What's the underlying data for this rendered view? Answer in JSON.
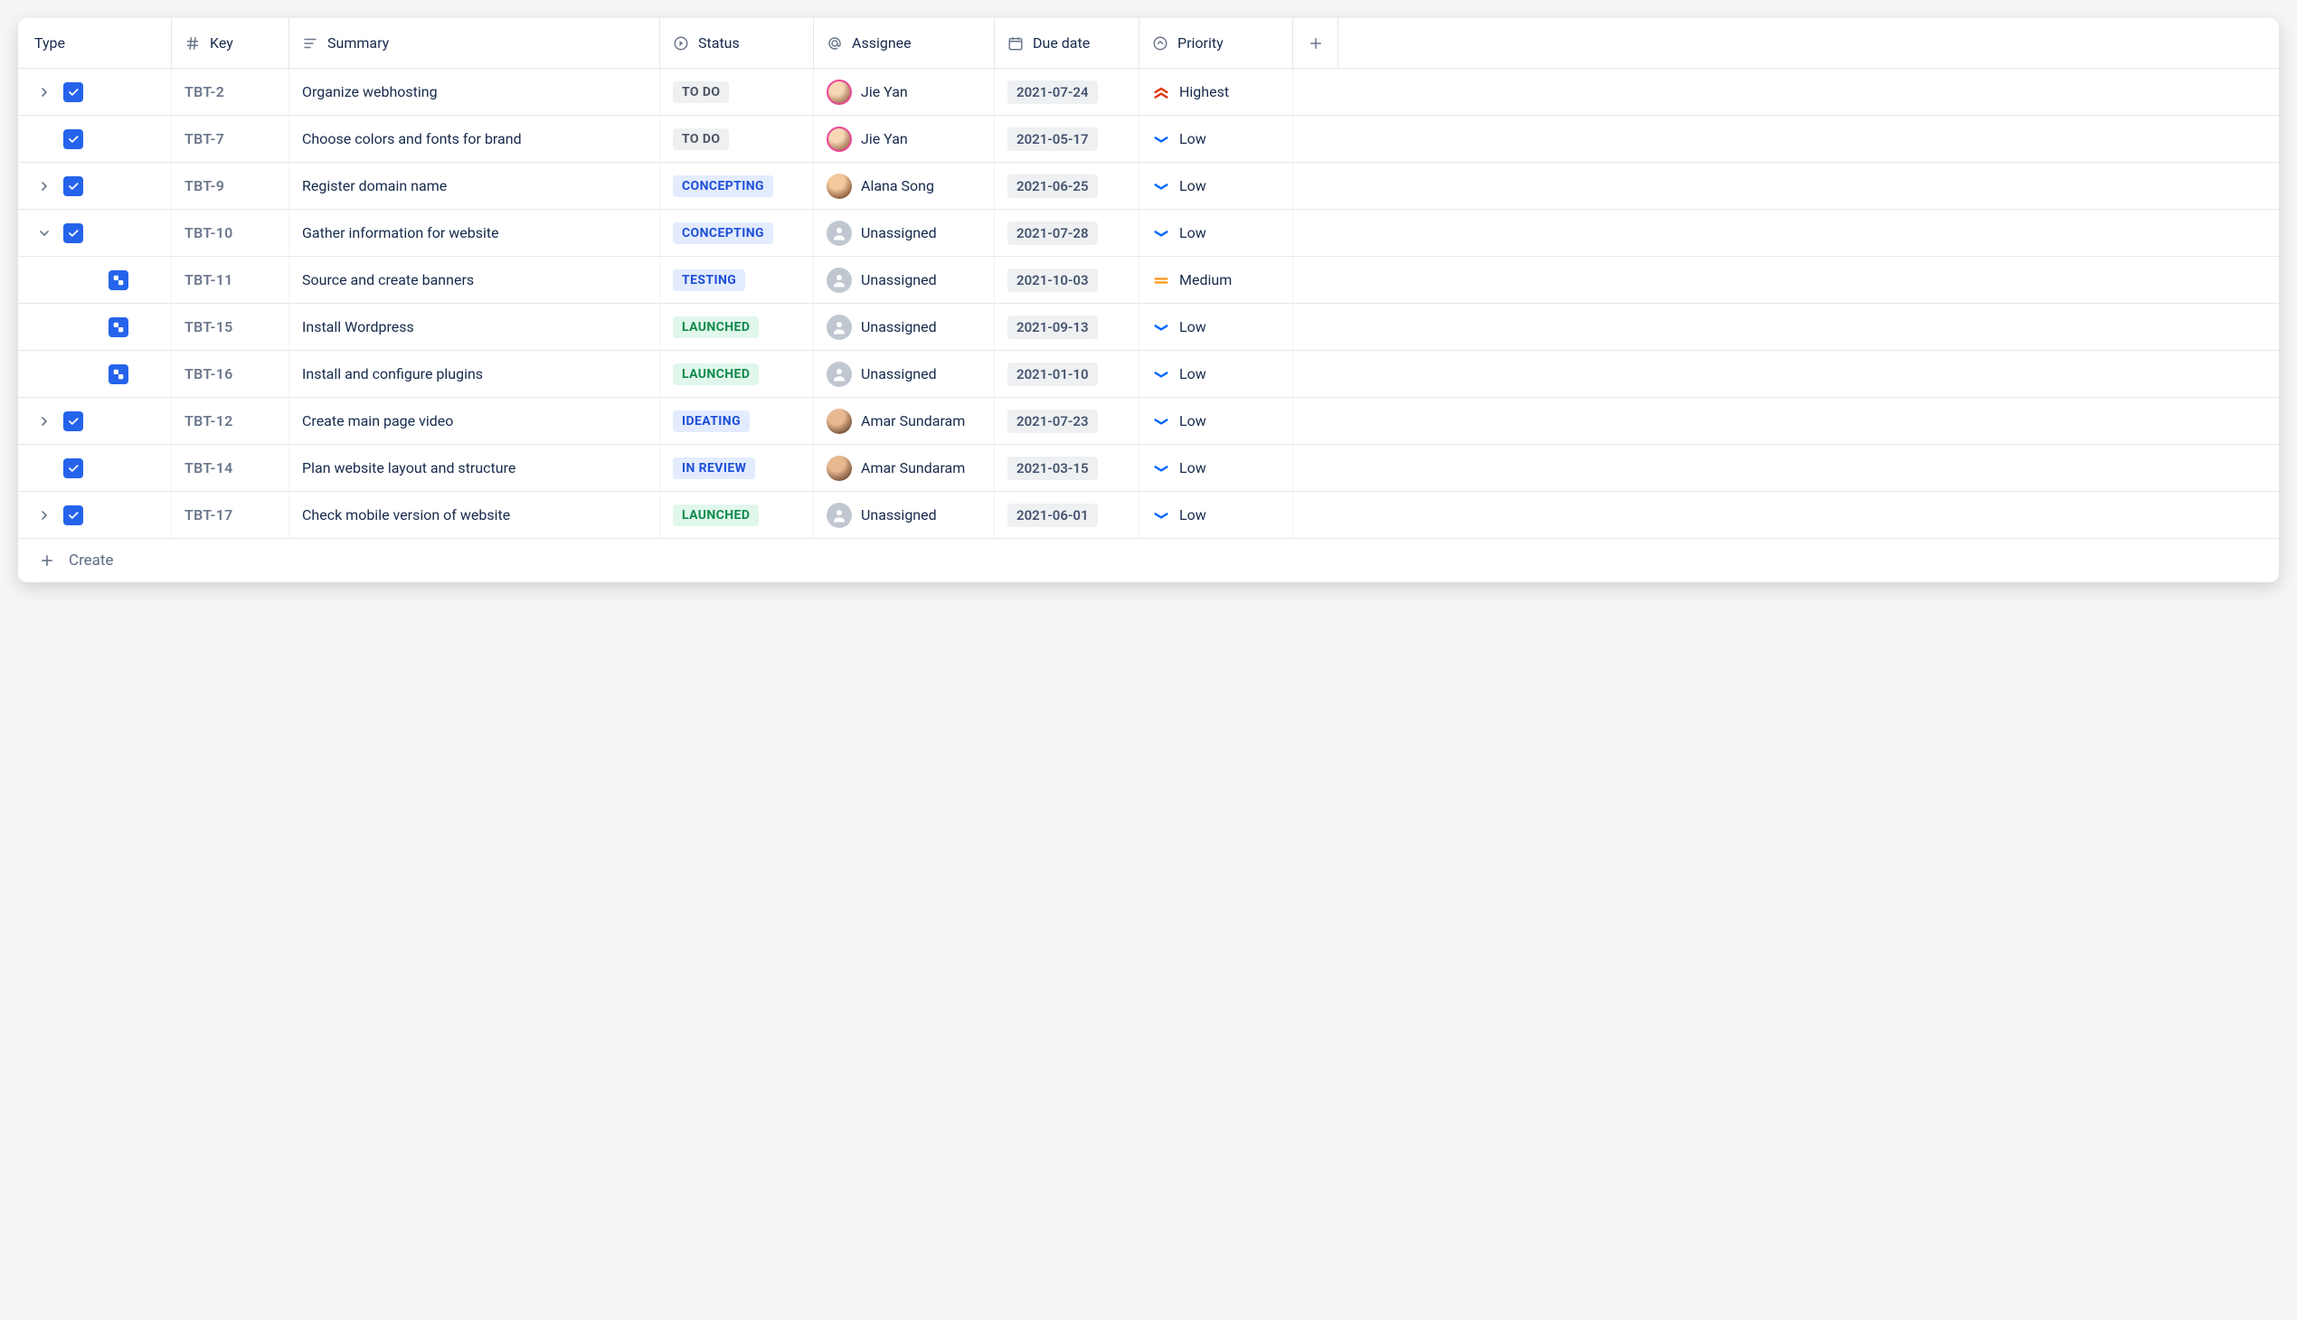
{
  "columns": {
    "type": "Type",
    "key": "Key",
    "summary": "Summary",
    "status": "Status",
    "assignee": "Assignee",
    "due_date": "Due date",
    "priority": "Priority"
  },
  "create_label": "Create",
  "priority_labels": {
    "highest": "Highest",
    "medium": "Medium",
    "low": "Low"
  },
  "status_styles": {
    "TO DO": "status-todo",
    "CONCEPTING": "status-blue",
    "IDEATING": "status-blue",
    "IN REVIEW": "status-blue",
    "TESTING": "status-blue",
    "LAUNCHED": "status-green"
  },
  "rows": [
    {
      "expand": "closed",
      "indent": 0,
      "icon": "task",
      "key": "TBT-2",
      "summary": "Organize webhosting",
      "status": "TO DO",
      "assignee": "Jie Yan",
      "avatar": "a1",
      "due": "2021-07-24",
      "priority": "highest"
    },
    {
      "expand": "none",
      "indent": 0,
      "icon": "task",
      "key": "TBT-7",
      "summary": "Choose colors and fonts for brand",
      "status": "TO DO",
      "assignee": "Jie Yan",
      "avatar": "a1",
      "due": "2021-05-17",
      "priority": "low"
    },
    {
      "expand": "closed",
      "indent": 0,
      "icon": "task",
      "key": "TBT-9",
      "summary": "Register domain name",
      "status": "CONCEPTING",
      "assignee": "Alana Song",
      "avatar": "a2",
      "due": "2021-06-25",
      "priority": "low"
    },
    {
      "expand": "open",
      "indent": 0,
      "icon": "task",
      "key": "TBT-10",
      "summary": "Gather information for website",
      "status": "CONCEPTING",
      "assignee": "Unassigned",
      "avatar": "unassigned",
      "due": "2021-07-28",
      "priority": "low"
    },
    {
      "expand": "none",
      "indent": 1,
      "icon": "subtask",
      "key": "TBT-11",
      "summary": "Source and create banners",
      "status": "TESTING",
      "assignee": "Unassigned",
      "avatar": "unassigned",
      "due": "2021-10-03",
      "priority": "medium"
    },
    {
      "expand": "none",
      "indent": 1,
      "icon": "subtask",
      "key": "TBT-15",
      "summary": "Install Wordpress",
      "status": "LAUNCHED",
      "assignee": "Unassigned",
      "avatar": "unassigned",
      "due": "2021-09-13",
      "priority": "low"
    },
    {
      "expand": "none",
      "indent": 1,
      "icon": "subtask",
      "key": "TBT-16",
      "summary": "Install and configure plugins",
      "status": "LAUNCHED",
      "assignee": "Unassigned",
      "avatar": "unassigned",
      "due": "2021-01-10",
      "priority": "low"
    },
    {
      "expand": "closed",
      "indent": 0,
      "icon": "task",
      "key": "TBT-12",
      "summary": "Create main page video",
      "status": "IDEATING",
      "assignee": "Amar Sundaram",
      "avatar": "a3",
      "due": "2021-07-23",
      "priority": "low"
    },
    {
      "expand": "none",
      "indent": 0,
      "icon": "task",
      "key": "TBT-14",
      "summary": "Plan website layout and structure",
      "status": "IN REVIEW",
      "assignee": "Amar Sundaram",
      "avatar": "a3",
      "due": "2021-03-15",
      "priority": "low"
    },
    {
      "expand": "closed",
      "indent": 0,
      "icon": "task",
      "key": "TBT-17",
      "summary": "Check mobile version of website",
      "status": "LAUNCHED",
      "assignee": "Unassigned",
      "avatar": "unassigned",
      "due": "2021-06-01",
      "priority": "low"
    }
  ]
}
